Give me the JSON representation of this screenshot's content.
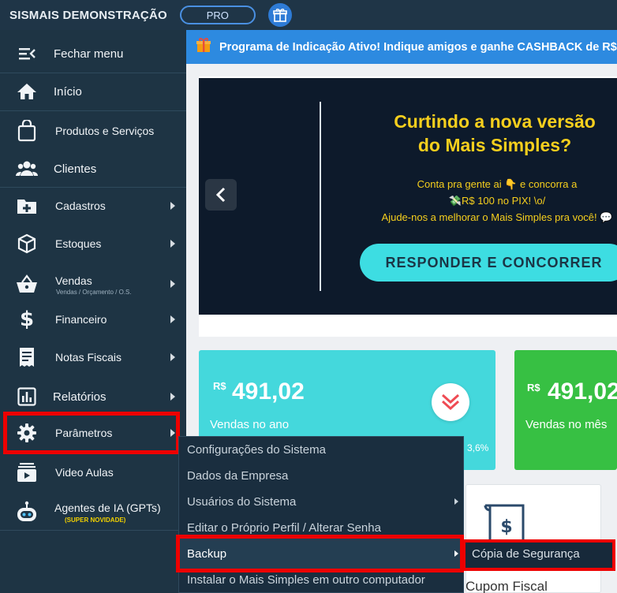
{
  "topbar": {
    "brand": "SISMAIS DEMONSTRAÇÃO",
    "plan_badge": "PRO",
    "gift_icon": "gift-icon"
  },
  "sidebar": {
    "items": [
      {
        "label": "Fechar menu",
        "icon": "menu-collapse-icon"
      },
      {
        "label": "Início",
        "icon": "home-icon"
      },
      {
        "label": "Produtos e Serviços",
        "icon": "shopping-bag-icon"
      },
      {
        "label": "Clientes",
        "icon": "users-icon"
      },
      {
        "label": "Cadastros",
        "icon": "folder-plus-icon"
      },
      {
        "label": "Estoques",
        "icon": "box-icon"
      },
      {
        "label": "Vendas",
        "sublabel": "Vendas / Orçamento / O.S.",
        "icon": "basket-icon"
      },
      {
        "label": "Financeiro",
        "icon": "dollar-icon"
      },
      {
        "label": "Notas Fiscais",
        "icon": "receipt-icon"
      },
      {
        "label": "Relatórios",
        "icon": "chart-icon"
      },
      {
        "label": "Parâmetros",
        "icon": "gear-icon"
      },
      {
        "label": "Video Aulas",
        "icon": "video-icon"
      },
      {
        "label": "Agentes de IA (GPTs)",
        "badge": "(SUPER NOVIDADE)",
        "icon": "robot-icon"
      }
    ]
  },
  "banner": {
    "text": "Programa de Indicação Ativo! Indique amigos e ganhe CASHBACK de R$"
  },
  "hero": {
    "title_line1": "Curtindo a nova versão",
    "title_line2": "do Mais Simples?",
    "text_line1": "Conta pra gente ai 👇 e concorra a",
    "text_line2": "💸R$ 100 no PIX! \\o/",
    "text_line3": "Ajude-nos a melhorar o Mais Simples pra você! 💬",
    "cta": "RESPONDER E CONCORRER"
  },
  "stats": [
    {
      "currency": "R$",
      "amount": "491,02",
      "label": "Vendas no ano",
      "change": "3,6%",
      "color": "#44d8dc"
    },
    {
      "currency": "R$",
      "amount": "491,02",
      "label": "Vendas no mês",
      "color": "#37c043"
    }
  ],
  "cupom": {
    "label": "Cupom Fiscal"
  },
  "submenu": {
    "items": [
      {
        "label": "Configurações do Sistema"
      },
      {
        "label": "Dados da Empresa"
      },
      {
        "label": "Usuários do Sistema"
      },
      {
        "label": "Editar o Próprio Perfil / Alterar Senha"
      },
      {
        "label": "Backup"
      },
      {
        "label": "Instalar o Mais Simples em outro computador"
      }
    ],
    "backup_submenu": {
      "label": "Cópia de Segurança"
    }
  },
  "colors": {
    "highlight": "#ee0000",
    "sidebar": "#1e3444",
    "accent": "#2d8ae0"
  }
}
